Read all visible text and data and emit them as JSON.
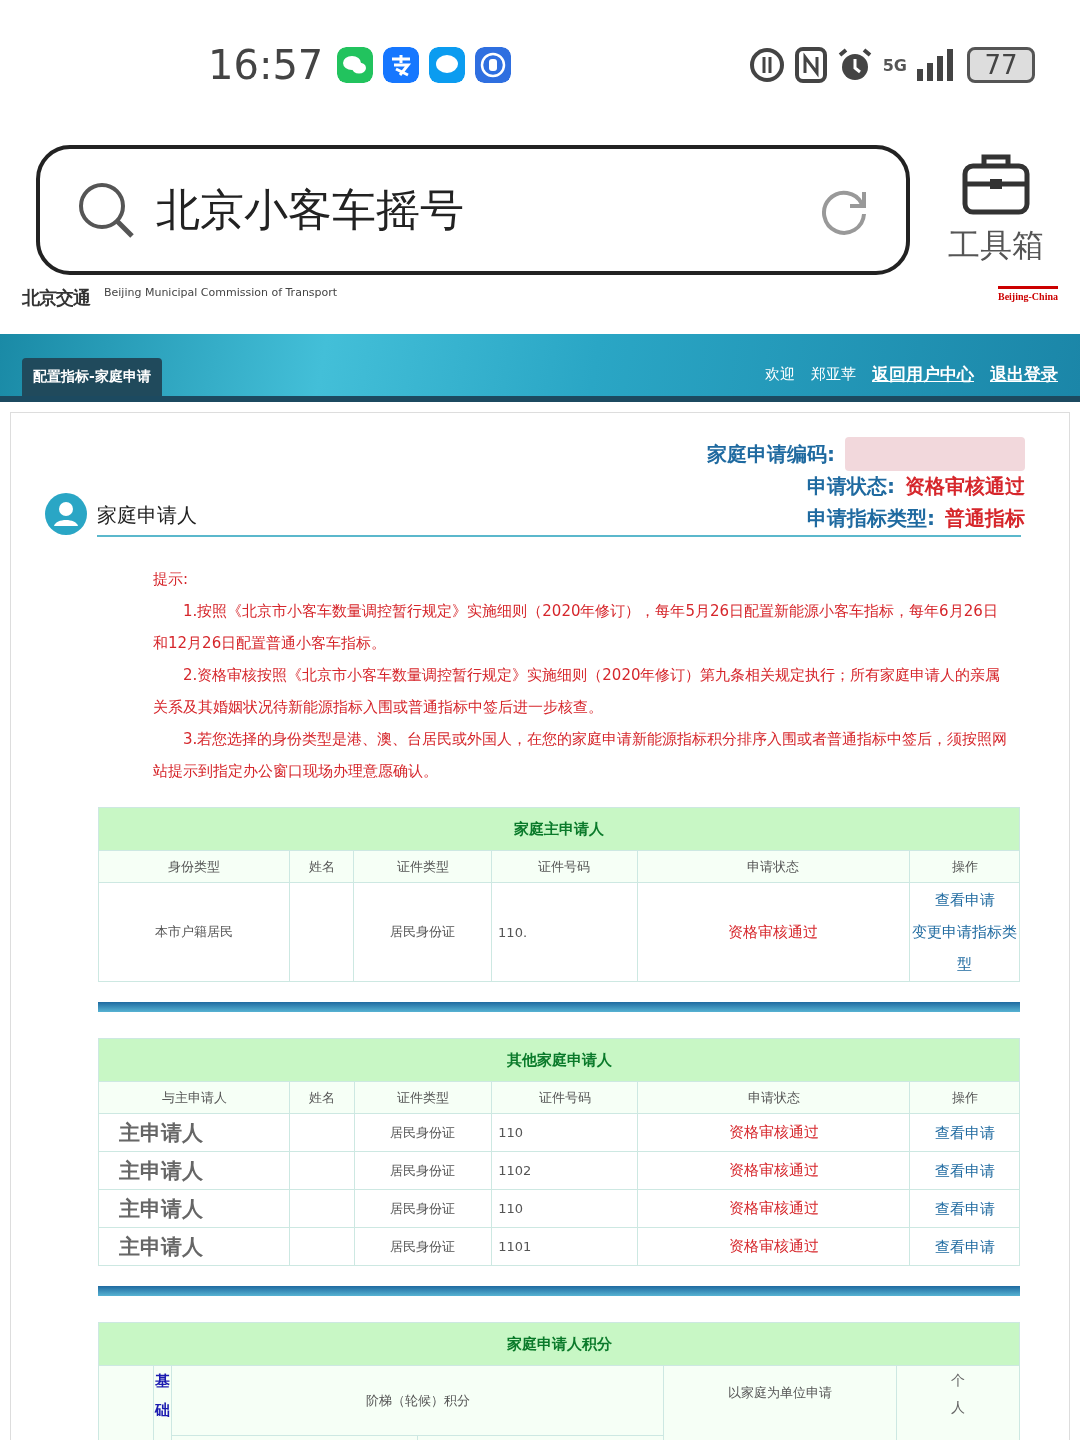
{
  "status_bar": {
    "time": "16:57",
    "battery": "77",
    "network": "5G"
  },
  "search": {
    "query": "北京小客车摇号",
    "toolbox_label": "工具箱"
  },
  "site_header": {
    "logo": "北京交通",
    "org_name": "Beijing Municipal Commission of Transport",
    "region_logo": "Beijing-China"
  },
  "banner": {
    "tab": "配置指标-家庭申请",
    "welcome": "欢迎",
    "user": "郑亚苹",
    "links": [
      "返回用户中心",
      "退出登录"
    ]
  },
  "summary": [
    {
      "label": "家庭申请编码:"
    },
    {
      "label": "申请状态:",
      "value": "资格审核通过"
    },
    {
      "label": "申请指标类型:",
      "value": "普通指标"
    }
  ],
  "section_title": "家庭申请人",
  "notes": {
    "title": "提示:",
    "items": [
      "1.按照《北京市小客车数量调控暂行规定》实施细则（2020年修订），每年5月26日配置新能源小客车指标，每年6月26日和12月26日配置普通小客车指标。",
      "2.资格审核按照《北京市小客车数量调控暂行规定》实施细则（2020年修订）第九条相关规定执行；所有家庭申请人的亲属关系及其婚姻状况待新能源指标入围或普通指标中签后进一步核查。",
      "3.若您选择的身份类型是港、澳、台居民或外国人，在您的家庭申请新能源指标积分排序入围或者普通指标中签后，须按照网站提示到指定办公窗口现场办理意愿确认。"
    ]
  },
  "main_applicant": {
    "title": "家庭主申请人",
    "columns": [
      "身份类型",
      "姓名",
      "证件类型",
      "证件号码",
      "申请状态",
      "操作"
    ],
    "rows": [
      {
        "identity": "本市户籍居民",
        "id_type": "居民身份证",
        "id_number": "110.",
        "status": "资格审核通过",
        "actions": [
          "查看申请",
          "变更申请指标类型"
        ]
      }
    ]
  },
  "other_applicants": {
    "title": "其他家庭申请人",
    "columns": [
      "与主申请人",
      "姓名",
      "证件类型",
      "证件号码",
      "申请状态",
      "操作"
    ],
    "rows": [
      {
        "relation": "主申请人",
        "id_type": "居民身份证",
        "id_number": "110",
        "status": "资格审核通过",
        "action": "查看申请"
      },
      {
        "relation": "主申请人",
        "id_type": "居民身份证",
        "id_number": "1102",
        "status": "资格审核通过",
        "action": "查看申请"
      },
      {
        "relation": "主申请人",
        "id_type": "居民身份证",
        "id_number": "110",
        "status": "资格审核通过",
        "action": "查看申请"
      },
      {
        "relation": "主申请人",
        "id_type": "居民身份证",
        "id_number": "1101",
        "status": "资格审核通过",
        "action": "查看申请"
      }
    ]
  },
  "points": {
    "title": "家庭申请人积分",
    "columns": [
      "基础",
      "阶梯（轮候）积分",
      "以家庭为单位申请",
      "个人"
    ]
  }
}
